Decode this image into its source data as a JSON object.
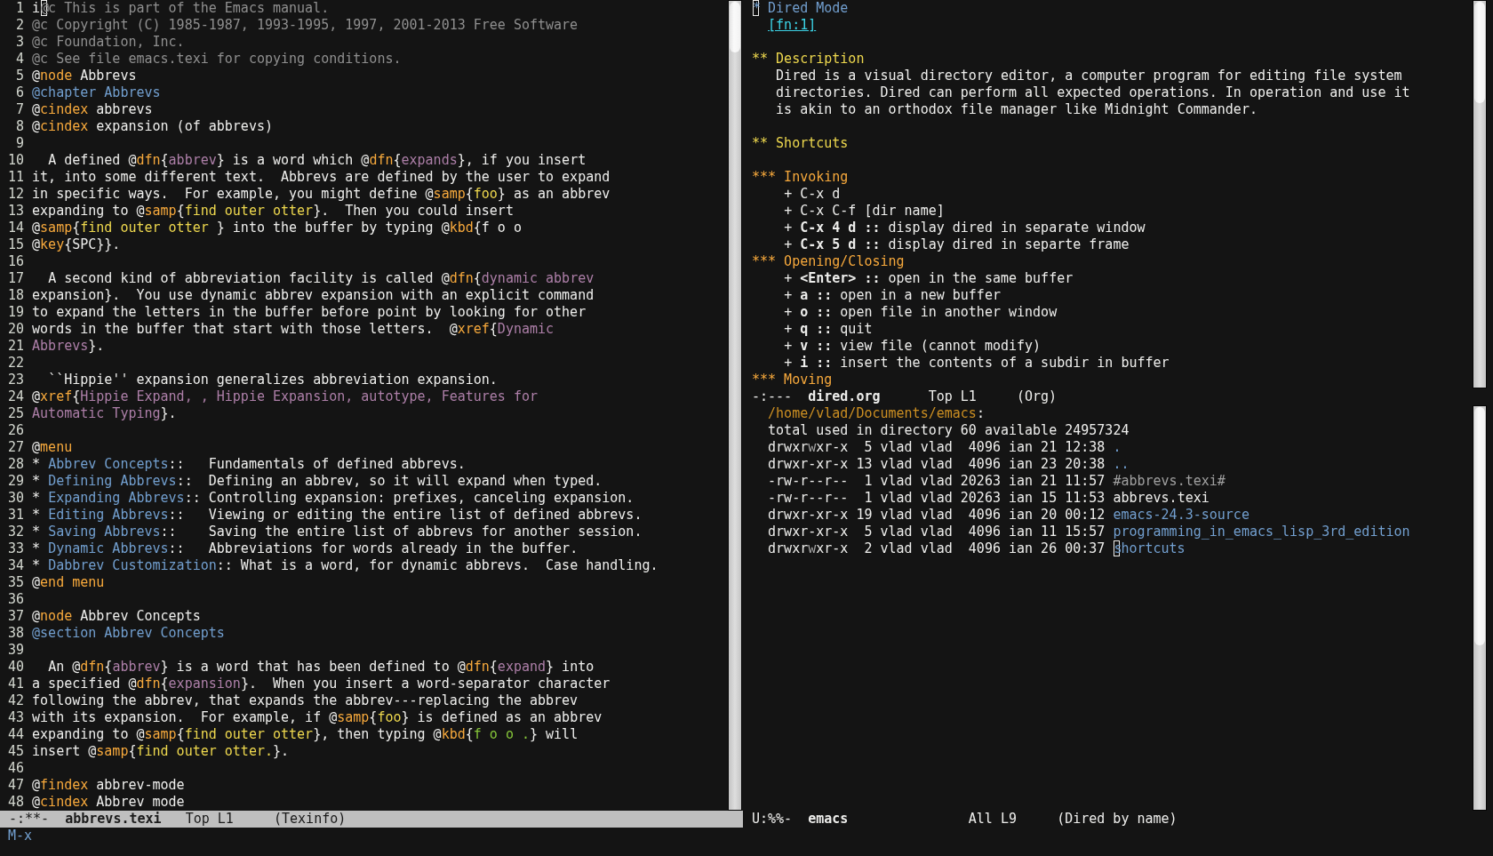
{
  "left_window": {
    "lines": [
      {
        "number": "1",
        "segments": [
          {
            "text": "i",
            "kind": "plain"
          },
          {
            "text": "@",
            "kind": "comment",
            "cursor": true
          },
          {
            "text": "c This is part of the Emacs manual.",
            "kind": "comment"
          }
        ]
      },
      {
        "number": "2",
        "segments": [
          {
            "text": "@c Copyright (C) 1985-1987, 1993-1995, 1997, 2001-2013 Free Software",
            "kind": "comment"
          }
        ]
      },
      {
        "number": "3",
        "segments": [
          {
            "text": "@c Foundation, Inc.",
            "kind": "comment"
          }
        ]
      },
      {
        "number": "4",
        "segments": [
          {
            "text": "@c See file emacs.texi for copying conditions.",
            "kind": "comment"
          }
        ]
      },
      {
        "number": "5",
        "segments": [
          {
            "text": "@",
            "kind": "plain"
          },
          {
            "text": "node",
            "kind": "command"
          },
          {
            "text": " Abbrevs",
            "kind": "plain"
          }
        ]
      },
      {
        "number": "6",
        "segments": [
          {
            "text": "@chapter Abbrevs",
            "kind": "title"
          }
        ]
      },
      {
        "number": "7",
        "segments": [
          {
            "text": "@",
            "kind": "plain"
          },
          {
            "text": "cindex",
            "kind": "command"
          },
          {
            "text": " abbrevs",
            "kind": "plain"
          }
        ]
      },
      {
        "number": "8",
        "segments": [
          {
            "text": "@",
            "kind": "plain"
          },
          {
            "text": "cindex",
            "kind": "command"
          },
          {
            "text": " expansion (of abbrevs)",
            "kind": "plain"
          }
        ]
      },
      {
        "number": "9"
      },
      {
        "number": "10",
        "segments": [
          {
            "text": "  A defined @",
            "kind": "plain"
          },
          {
            "text": "dfn",
            "kind": "command"
          },
          {
            "text": "{",
            "kind": "plain"
          },
          {
            "text": "abbrev",
            "kind": "term"
          },
          {
            "text": "} is a word which @",
            "kind": "plain"
          },
          {
            "text": "dfn",
            "kind": "command"
          },
          {
            "text": "{",
            "kind": "plain"
          },
          {
            "text": "expands",
            "kind": "term"
          },
          {
            "text": "}, if you insert",
            "kind": "plain"
          }
        ]
      },
      {
        "number": "11",
        "segments": [
          {
            "text": "it, into some different text.  Abbrevs are defined by the user to expand",
            "kind": "plain"
          }
        ]
      },
      {
        "number": "12",
        "segments": [
          {
            "text": "in specific ways.  For example, you might define @",
            "kind": "plain"
          },
          {
            "text": "samp",
            "kind": "command"
          },
          {
            "text": "{",
            "kind": "plain"
          },
          {
            "text": "foo",
            "kind": "sample"
          },
          {
            "text": "} as an abbrev",
            "kind": "plain"
          }
        ]
      },
      {
        "number": "13",
        "segments": [
          {
            "text": "expanding to @",
            "kind": "plain"
          },
          {
            "text": "samp",
            "kind": "command"
          },
          {
            "text": "{",
            "kind": "plain"
          },
          {
            "text": "find outer otter",
            "kind": "sample"
          },
          {
            "text": "}.  Then you could insert",
            "kind": "plain"
          }
        ]
      },
      {
        "number": "14",
        "segments": [
          {
            "text": "@",
            "kind": "plain"
          },
          {
            "text": "samp",
            "kind": "command"
          },
          {
            "text": "{",
            "kind": "plain"
          },
          {
            "text": "find outer otter ",
            "kind": "sample"
          },
          {
            "text": "} into the buffer by typing @",
            "kind": "plain"
          },
          {
            "text": "kbd",
            "kind": "command"
          },
          {
            "text": "{f o o",
            "kind": "plain"
          }
        ]
      },
      {
        "number": "15",
        "segments": [
          {
            "text": "@",
            "kind": "plain"
          },
          {
            "text": "key",
            "kind": "command"
          },
          {
            "text": "{SPC}}.",
            "kind": "plain"
          }
        ]
      },
      {
        "number": "16"
      },
      {
        "number": "17",
        "segments": [
          {
            "text": "  A second kind of abbreviation facility is called @",
            "kind": "plain"
          },
          {
            "text": "dfn",
            "kind": "command"
          },
          {
            "text": "{",
            "kind": "plain"
          },
          {
            "text": "dynamic abbrev",
            "kind": "term"
          }
        ]
      },
      {
        "number": "18",
        "segments": [
          {
            "text": "expansion}.  You use dynamic abbrev expansion with an explicit command",
            "kind": "plain"
          }
        ]
      },
      {
        "number": "19",
        "segments": [
          {
            "text": "to expand the letters in the buffer before point by looking for other",
            "kind": "plain"
          }
        ]
      },
      {
        "number": "20",
        "segments": [
          {
            "text": "words in the buffer that start with those letters.  @",
            "kind": "plain"
          },
          {
            "text": "xref",
            "kind": "command"
          },
          {
            "text": "{",
            "kind": "plain"
          },
          {
            "text": "Dynamic",
            "kind": "term"
          }
        ]
      },
      {
        "number": "21",
        "segments": [
          {
            "text": "Abbrevs",
            "kind": "term"
          },
          {
            "text": "}.",
            "kind": "plain"
          }
        ]
      },
      {
        "number": "22"
      },
      {
        "number": "23",
        "segments": [
          {
            "text": "  ``Hippie'' expansion generalizes abbreviation expansion.",
            "kind": "plain"
          }
        ]
      },
      {
        "number": "24",
        "segments": [
          {
            "text": "@",
            "kind": "plain"
          },
          {
            "text": "xref",
            "kind": "command"
          },
          {
            "text": "{",
            "kind": "plain"
          },
          {
            "text": "Hippie Expand, , Hippie Expansion, autotype, Features for",
            "kind": "term"
          }
        ]
      },
      {
        "number": "25",
        "segments": [
          {
            "text": "Automatic Typing",
            "kind": "term"
          },
          {
            "text": "}.",
            "kind": "plain"
          }
        ]
      },
      {
        "number": "26"
      },
      {
        "number": "27",
        "segments": [
          {
            "text": "@",
            "kind": "plain"
          },
          {
            "text": "menu",
            "kind": "command"
          }
        ]
      },
      {
        "number": "28",
        "segments": [
          {
            "text": "* ",
            "kind": "plain"
          },
          {
            "text": "Abbrev Concepts",
            "kind": "title"
          },
          {
            "text": "::   Fundamentals of defined abbrevs.",
            "kind": "plain"
          }
        ]
      },
      {
        "number": "29",
        "segments": [
          {
            "text": "* ",
            "kind": "plain"
          },
          {
            "text": "Defining Abbrevs",
            "kind": "title"
          },
          {
            "text": "::  Defining an abbrev, so it will expand when typed.",
            "kind": "plain"
          }
        ]
      },
      {
        "number": "30",
        "segments": [
          {
            "text": "* ",
            "kind": "plain"
          },
          {
            "text": "Expanding Abbrevs",
            "kind": "title"
          },
          {
            "text": ":: Controlling expansion: prefixes, canceling expansion.",
            "kind": "plain"
          }
        ]
      },
      {
        "number": "31",
        "segments": [
          {
            "text": "* ",
            "kind": "plain"
          },
          {
            "text": "Editing Abbrevs",
            "kind": "title"
          },
          {
            "text": "::   Viewing or editing the entire list of defined abbrevs.",
            "kind": "plain"
          }
        ]
      },
      {
        "number": "32",
        "segments": [
          {
            "text": "* ",
            "kind": "plain"
          },
          {
            "text": "Saving Abbrevs",
            "kind": "title"
          },
          {
            "text": "::    Saving the entire list of abbrevs for another session.",
            "kind": "plain"
          }
        ]
      },
      {
        "number": "33",
        "segments": [
          {
            "text": "* ",
            "kind": "plain"
          },
          {
            "text": "Dynamic Abbrevs",
            "kind": "title"
          },
          {
            "text": "::   Abbreviations for words already in the buffer.",
            "kind": "plain"
          }
        ]
      },
      {
        "number": "34",
        "segments": [
          {
            "text": "* ",
            "kind": "plain"
          },
          {
            "text": "Dabbrev Customization",
            "kind": "title"
          },
          {
            "text": ":: What is a word, for dynamic abbrevs.  Case handling.",
            "kind": "plain"
          }
        ]
      },
      {
        "number": "35",
        "segments": [
          {
            "text": "@",
            "kind": "plain"
          },
          {
            "text": "end menu",
            "kind": "command"
          }
        ]
      },
      {
        "number": "36"
      },
      {
        "number": "37",
        "segments": [
          {
            "text": "@",
            "kind": "plain"
          },
          {
            "text": "node",
            "kind": "command"
          },
          {
            "text": " Abbrev Concepts",
            "kind": "plain"
          }
        ]
      },
      {
        "number": "38",
        "segments": [
          {
            "text": "@section Abbrev Concepts",
            "kind": "title"
          }
        ]
      },
      {
        "number": "39"
      },
      {
        "number": "40",
        "segments": [
          {
            "text": "  An @",
            "kind": "plain"
          },
          {
            "text": "dfn",
            "kind": "command"
          },
          {
            "text": "{",
            "kind": "plain"
          },
          {
            "text": "abbrev",
            "kind": "term"
          },
          {
            "text": "} is a word that has been defined to @",
            "kind": "plain"
          },
          {
            "text": "dfn",
            "kind": "command"
          },
          {
            "text": "{",
            "kind": "plain"
          },
          {
            "text": "expand",
            "kind": "term"
          },
          {
            "text": "} into",
            "kind": "plain"
          }
        ]
      },
      {
        "number": "41",
        "segments": [
          {
            "text": "a specified @",
            "kind": "plain"
          },
          {
            "text": "dfn",
            "kind": "command"
          },
          {
            "text": "{",
            "kind": "plain"
          },
          {
            "text": "expansion",
            "kind": "term"
          },
          {
            "text": "}.  When you insert a word-separator character",
            "kind": "plain"
          }
        ]
      },
      {
        "number": "42",
        "segments": [
          {
            "text": "following the abbrev, that expands the abbrev---replacing the abbrev",
            "kind": "plain"
          }
        ]
      },
      {
        "number": "43",
        "segments": [
          {
            "text": "with its expansion.  For example, if @",
            "kind": "plain"
          },
          {
            "text": "samp",
            "kind": "command"
          },
          {
            "text": "{",
            "kind": "plain"
          },
          {
            "text": "foo",
            "kind": "sample"
          },
          {
            "text": "} is defined as an abbrev",
            "kind": "plain"
          }
        ]
      },
      {
        "number": "44",
        "segments": [
          {
            "text": "expanding to @",
            "kind": "plain"
          },
          {
            "text": "samp",
            "kind": "command"
          },
          {
            "text": "{",
            "kind": "plain"
          },
          {
            "text": "find outer otter",
            "kind": "sample"
          },
          {
            "text": "}, then typing @",
            "kind": "plain"
          },
          {
            "text": "kbd",
            "kind": "command"
          },
          {
            "text": "{",
            "kind": "plain"
          },
          {
            "text": "f o o .",
            "kind": "keys"
          },
          {
            "text": "} will",
            "kind": "plain"
          }
        ]
      },
      {
        "number": "45",
        "segments": [
          {
            "text": "insert @",
            "kind": "plain"
          },
          {
            "text": "samp",
            "kind": "command"
          },
          {
            "text": "{",
            "kind": "plain"
          },
          {
            "text": "find outer otter.",
            "kind": "sample"
          },
          {
            "text": "}.",
            "kind": "plain"
          }
        ]
      },
      {
        "number": "46"
      },
      {
        "number": "47",
        "segments": [
          {
            "text": "@",
            "kind": "plain"
          },
          {
            "text": "findex",
            "kind": "command"
          },
          {
            "text": " abbrev-mode",
            "kind": "plain"
          }
        ]
      },
      {
        "number": "48",
        "segments": [
          {
            "text": "@",
            "kind": "plain"
          },
          {
            "text": "cindex",
            "kind": "command"
          },
          {
            "text": " Abbrev mode",
            "kind": "plain"
          }
        ]
      }
    ],
    "mode_line": {
      "active": true,
      "status": "-:**-",
      "buffer": "abbrevs.texi",
      "position": "Top L1",
      "mode": "(Texinfo)"
    }
  },
  "org_window": {
    "lines": [
      {
        "kind": "text",
        "segments": [
          {
            "text": "*",
            "kind": "level1",
            "cursor": true
          },
          {
            "text": " Dired Mode",
            "kind": "level1"
          }
        ]
      },
      {
        "kind": "text",
        "segments": [
          {
            "text": "  [fn:1]",
            "kind": "link"
          }
        ]
      },
      {
        "kind": "blank"
      },
      {
        "kind": "text",
        "segments": [
          {
            "text": "** Description",
            "kind": "level2"
          }
        ]
      },
      {
        "kind": "text",
        "segments": [
          {
            "text": "   Dired is a visual directory editor, a computer program for editing file system",
            "kind": "plain"
          }
        ]
      },
      {
        "kind": "text",
        "segments": [
          {
            "text": "   directories. Dired can perform all expected operations. In operation and use it",
            "kind": "plain"
          }
        ]
      },
      {
        "kind": "text",
        "segments": [
          {
            "text": "   is akin to an orthodox file manager like Midnight Commander.",
            "kind": "plain"
          }
        ]
      },
      {
        "kind": "blank"
      },
      {
        "kind": "text",
        "segments": [
          {
            "text": "** Shortcuts",
            "kind": "level2"
          }
        ]
      },
      {
        "kind": "blank"
      },
      {
        "kind": "text",
        "segments": [
          {
            "text": "*** Invoking",
            "kind": "level3"
          }
        ]
      },
      {
        "kind": "text",
        "segments": [
          {
            "text": "    + C-x d",
            "kind": "plain"
          }
        ]
      },
      {
        "kind": "text",
        "segments": [
          {
            "text": "    + C-x C-f [dir name]",
            "kind": "plain"
          }
        ]
      },
      {
        "kind": "text",
        "segments": [
          {
            "text": "    + ",
            "kind": "plain"
          },
          {
            "text": "C-x 4 d ::",
            "kind": "bold"
          },
          {
            "text": " display dired in separate window",
            "kind": "plain"
          }
        ]
      },
      {
        "kind": "text",
        "segments": [
          {
            "text": "    + ",
            "kind": "plain"
          },
          {
            "text": "C-x 5 d ::",
            "kind": "bold"
          },
          {
            "text": " display dired in separte frame",
            "kind": "plain"
          }
        ]
      },
      {
        "kind": "text",
        "segments": [
          {
            "text": "*** Opening/Closing",
            "kind": "level3"
          }
        ]
      },
      {
        "kind": "text",
        "segments": [
          {
            "text": "    + ",
            "kind": "plain"
          },
          {
            "text": "<Enter> ::",
            "kind": "bold"
          },
          {
            "text": " open in the same buffer",
            "kind": "plain"
          }
        ]
      },
      {
        "kind": "text",
        "segments": [
          {
            "text": "    + ",
            "kind": "plain"
          },
          {
            "text": "a ::",
            "kind": "bold"
          },
          {
            "text": " open in a new buffer",
            "kind": "plain"
          }
        ]
      },
      {
        "kind": "text",
        "segments": [
          {
            "text": "    + ",
            "kind": "plain"
          },
          {
            "text": "o ::",
            "kind": "bold"
          },
          {
            "text": " open file in another window",
            "kind": "plain"
          }
        ]
      },
      {
        "kind": "text",
        "segments": [
          {
            "text": "    + ",
            "kind": "plain"
          },
          {
            "text": "q ::",
            "kind": "bold"
          },
          {
            "text": " quit",
            "kind": "plain"
          }
        ]
      },
      {
        "kind": "text",
        "segments": [
          {
            "text": "    + ",
            "kind": "plain"
          },
          {
            "text": "v ::",
            "kind": "bold"
          },
          {
            "text": " view file (cannot modify)",
            "kind": "plain"
          }
        ]
      },
      {
        "kind": "text",
        "segments": [
          {
            "text": "    + ",
            "kind": "plain"
          },
          {
            "text": "i ::",
            "kind": "bold"
          },
          {
            "text": " insert the contents of a subdir in buffer",
            "kind": "plain"
          }
        ]
      },
      {
        "kind": "text",
        "segments": [
          {
            "text": "*** Moving",
            "kind": "level3"
          }
        ]
      }
    ],
    "mode_line": {
      "active": false,
      "status": "-:---",
      "buffer": "dired.org",
      "position": "Top L1",
      "mode": "(Org)"
    }
  },
  "dired_window": {
    "header": {
      "segments": [
        {
          "text": "  /home/vlad/Documents/emacs",
          "kind": "path"
        },
        {
          "text": ":",
          "kind": "plain"
        }
      ]
    },
    "summary": {
      "segments": [
        {
          "text": "  total used in directory 60 available 24957324",
          "kind": "plain"
        }
      ]
    },
    "entries": [
      {
        "segments": [
          {
            "text": "  drwxr",
            "kind": "plain"
          },
          {
            "text": "w",
            "kind": "flag"
          },
          {
            "text": "xr-x  5 vlad vlad  4096 ian 21 12:38 ",
            "kind": "plain"
          },
          {
            "text": ".",
            "kind": "directory"
          }
        ]
      },
      {
        "segments": [
          {
            "text": "  drwxr-xr-x 13 vlad vlad  4096 ian 23 20:38 ",
            "kind": "plain"
          },
          {
            "text": "..",
            "kind": "directory"
          }
        ]
      },
      {
        "segments": [
          {
            "text": "  -rw-r--r--  1 vlad vlad 20263 ian 21 11:57 ",
            "kind": "plain"
          },
          {
            "text": "#abbrevs.texi#",
            "kind": "backup"
          }
        ]
      },
      {
        "segments": [
          {
            "text": "  -rw-r--r--  1 vlad vlad 20263 ian 15 11:53 abbrevs.texi",
            "kind": "plain"
          }
        ]
      },
      {
        "segments": [
          {
            "text": "  drwxr-xr-x 19 vlad vlad  4096 ian 20 00:12 ",
            "kind": "plain"
          },
          {
            "text": "emacs-24.3-source",
            "kind": "directory"
          }
        ]
      },
      {
        "segments": [
          {
            "text": "  drwxr-xr-x  5 vlad vlad  4096 ian 11 15:57 ",
            "kind": "plain"
          },
          {
            "text": "programming_in_emacs_lisp_3rd_edition",
            "kind": "directory"
          }
        ]
      },
      {
        "segments": [
          {
            "text": "  drwxr",
            "kind": "plain"
          },
          {
            "text": "w",
            "kind": "flag"
          },
          {
            "text": "xr-x  2 vlad vlad  4096 ian 26 00:37 ",
            "kind": "plain"
          },
          {
            "text": "s",
            "kind": "directory",
            "cursor": true
          },
          {
            "text": "hortcuts",
            "kind": "directory"
          }
        ]
      }
    ],
    "mode_line": {
      "active": false,
      "status": "U:%%-",
      "buffer": "emacs",
      "position": "All L9",
      "mode": "(Dired by name)"
    }
  },
  "minibuffer": {
    "prompt": "M-x"
  }
}
